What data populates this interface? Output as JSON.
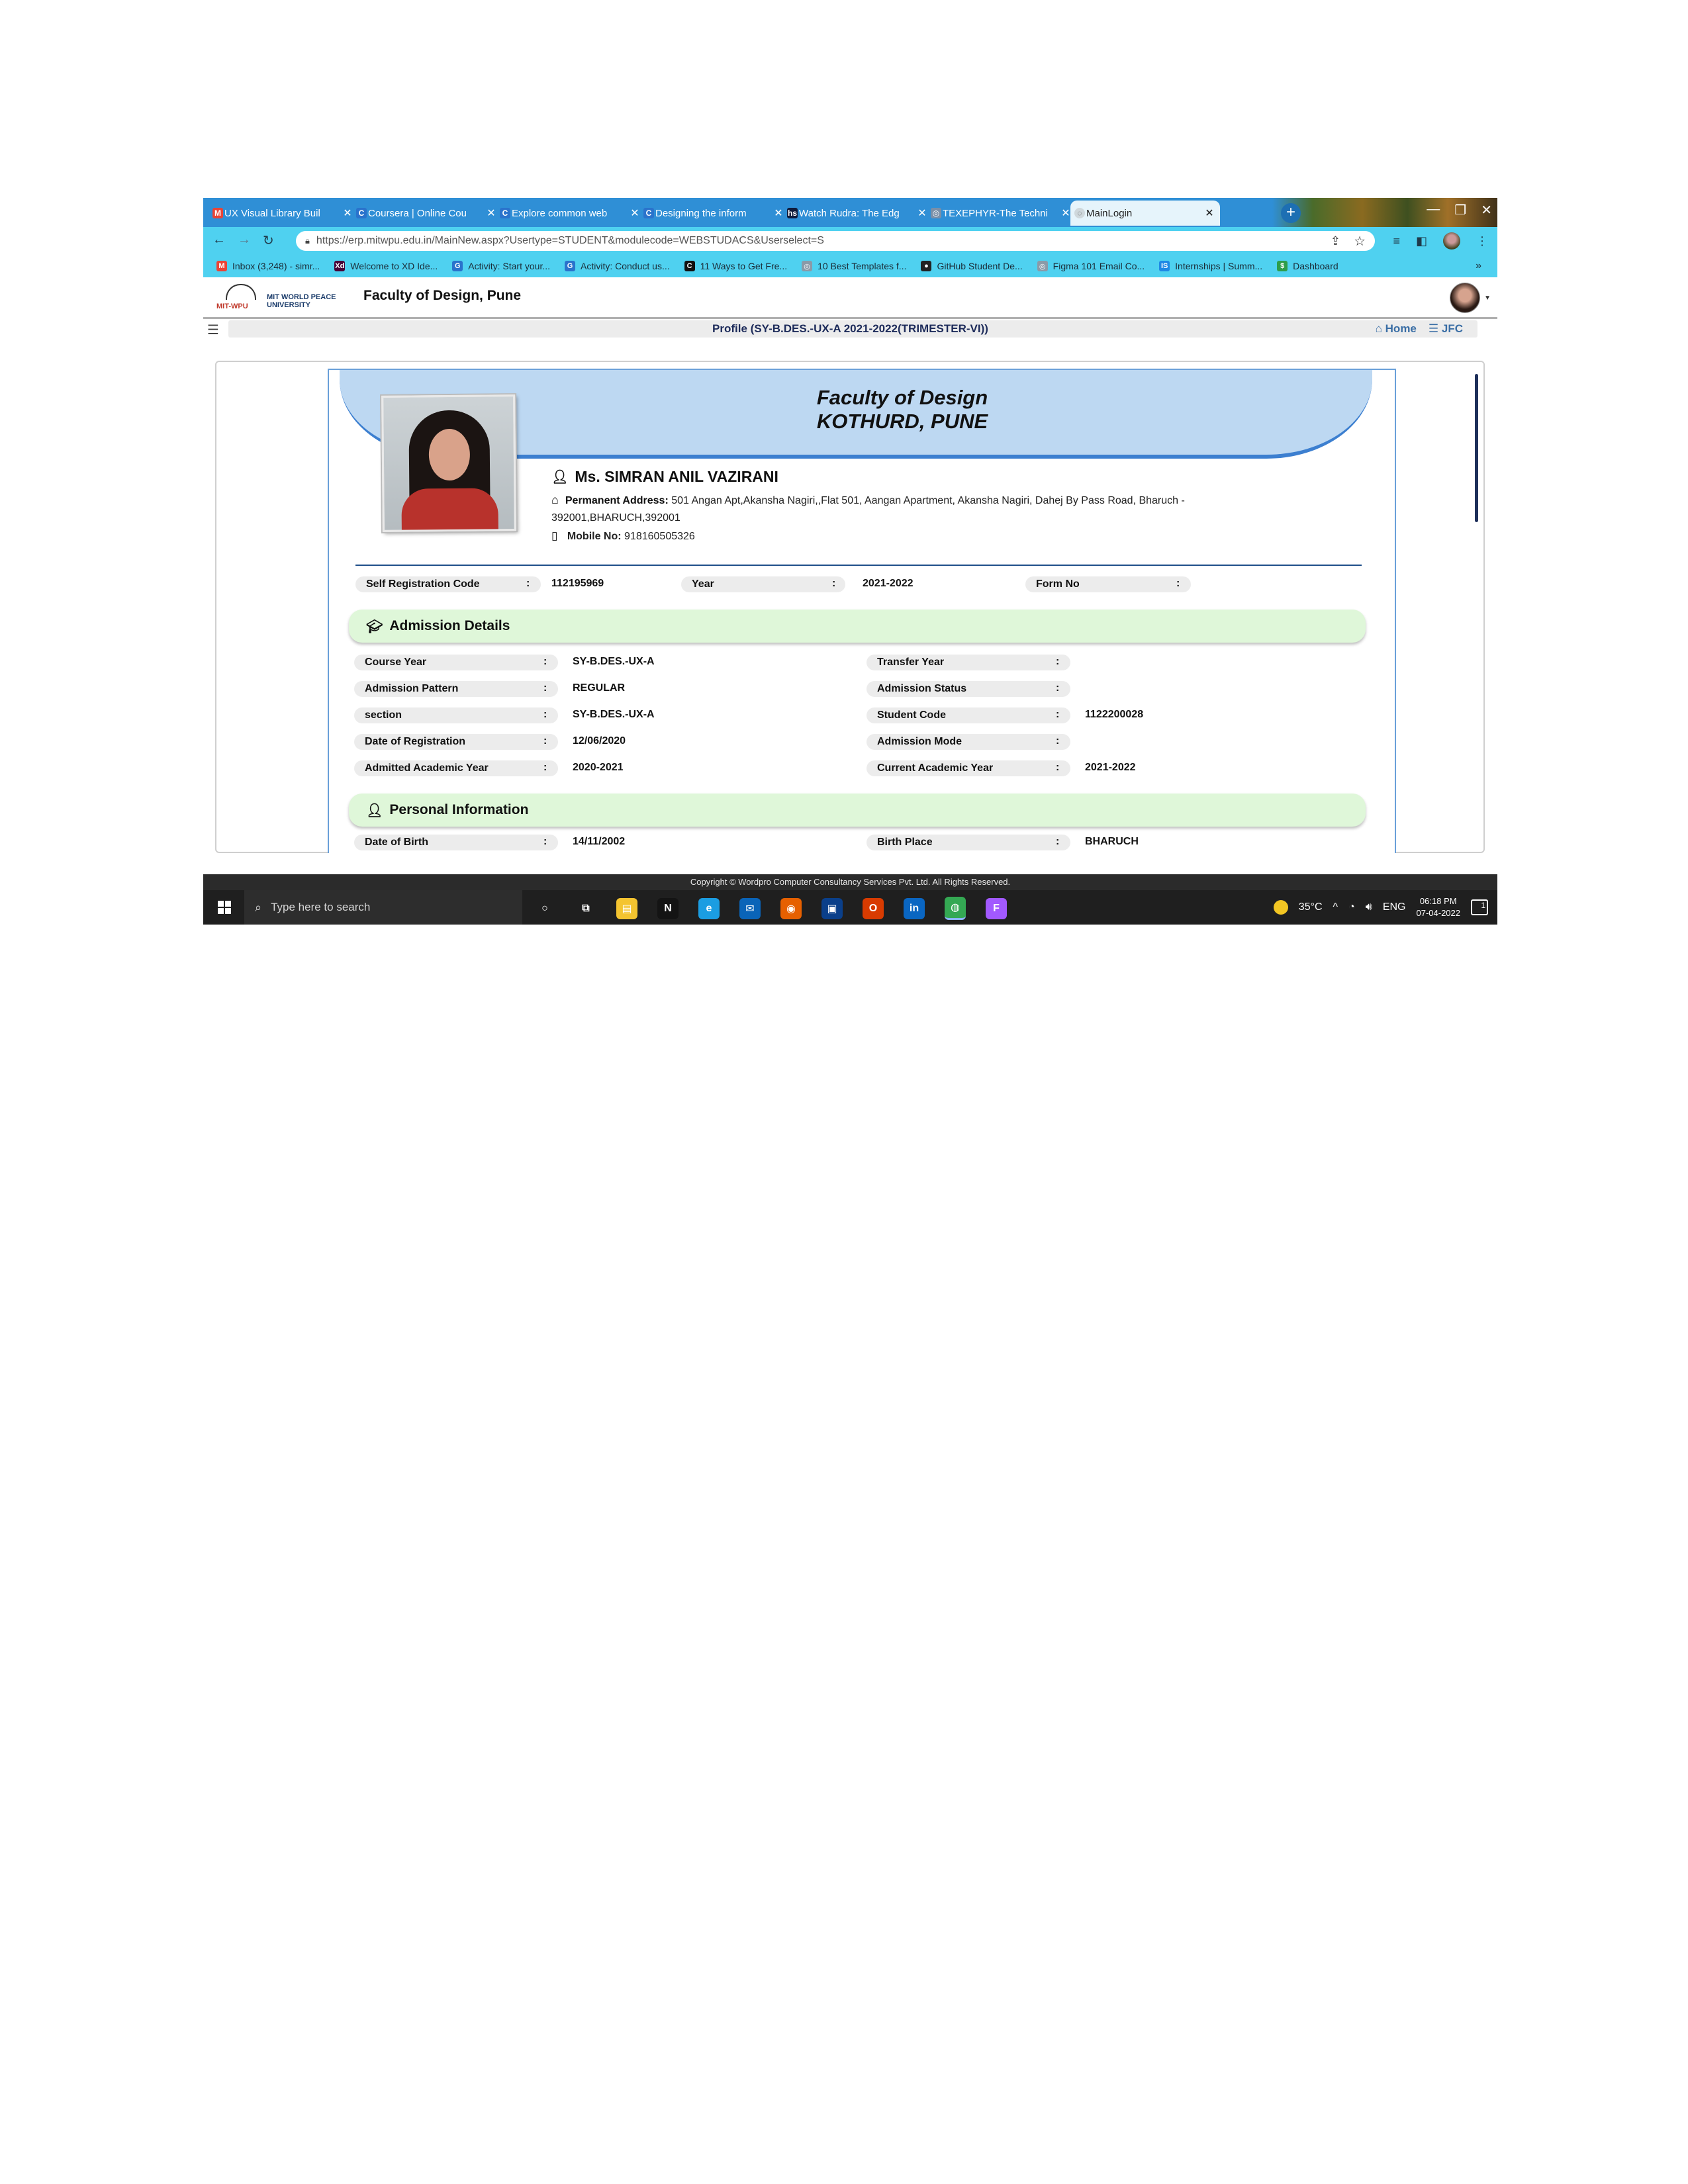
{
  "browser": {
    "tabs": [
      {
        "title": "UX Visual Library Buil",
        "favicon": "gmail-icon",
        "color": "#ea4335",
        "glyph": "M"
      },
      {
        "title": "Coursera | Online Cou",
        "favicon": "coursera-icon",
        "color": "#2a73cc",
        "glyph": "C"
      },
      {
        "title": "Explore common web",
        "favicon": "coursera-icon",
        "color": "#2a73cc",
        "glyph": "C"
      },
      {
        "title": "Designing the inform",
        "favicon": "coursera-icon",
        "color": "#2a73cc",
        "glyph": "C"
      },
      {
        "title": "Watch Rudra: The Edg",
        "favicon": "hotstar-icon",
        "color": "#0f1a3a",
        "glyph": "hs"
      },
      {
        "title": "TEXEPHYR-The Techni",
        "favicon": "globe-icon",
        "color": "#7a8fa8",
        "glyph": "◎"
      },
      {
        "title": "MainLogin",
        "favicon": "loading-icon",
        "color": "#cfd8dc",
        "glyph": "◌",
        "active": true
      }
    ],
    "url": "https://erp.mitwpu.edu.in/MainNew.aspx?Usertype=STUDENT&modulecode=WEBSTUDACS&Userselect=S",
    "bookmarks": [
      {
        "label": "Inbox (3,248) - simr...",
        "icon": "gmail-icon",
        "color": "#ea4335",
        "glyph": "M"
      },
      {
        "label": "Welcome to XD Ide...",
        "icon": "xd-icon",
        "color": "#470137",
        "glyph": "Xd"
      },
      {
        "label": "Activity: Start your...",
        "icon": "google-icon",
        "color": "#2a73cc",
        "glyph": "G"
      },
      {
        "label": "Activity: Conduct us...",
        "icon": "google-icon",
        "color": "#2a73cc",
        "glyph": "G"
      },
      {
        "label": "11 Ways to Get Fre...",
        "icon": "c-icon",
        "color": "#111111",
        "glyph": "C"
      },
      {
        "label": "10 Best Templates f...",
        "icon": "globe-icon",
        "color": "#8a9aa8",
        "glyph": "◎"
      },
      {
        "label": "GitHub Student De...",
        "icon": "github-icon",
        "color": "#222222",
        "glyph": "●"
      },
      {
        "label": "Figma 101 Email Co...",
        "icon": "globe-icon",
        "color": "#8a9aa8",
        "glyph": "◎"
      },
      {
        "label": "Internships | Summ...",
        "icon": "internshala-icon",
        "color": "#1e88e5",
        "glyph": "IS"
      },
      {
        "label": "Dashboard",
        "icon": "dollar-icon",
        "color": "#2e9d4a",
        "glyph": "$"
      }
    ],
    "more": "»"
  },
  "app": {
    "logo_lines": [
      "MIT WORLD PEACE",
      "UNIVERSITY"
    ],
    "logo_mark": "MIT-WPU",
    "header_title": "Faculty of Design, Pune",
    "page_title": "Profile  (SY-B.DES.-UX-A   2021-2022(TRIMESTER-VI))",
    "home_link": "Home",
    "jfc_link": "JFC"
  },
  "profile": {
    "faculty_line1": "Faculty of Design",
    "faculty_line2": "KOTHURD, PUNE",
    "name": "Ms. SIMRAN ANIL VAZIRANI",
    "address_label": "Permanent Address:",
    "address_line1": "501 Angan Apt,Akansha Nagiri,,Flat 501, Aangan Apartment, Akansha Nagiri, Dahej By Pass Road, Bharuch -",
    "address_line2": "392001,BHARUCH,392001",
    "mobile_label": "Mobile No:",
    "mobile": "918160505326",
    "self_reg_label": "Self Registration Code",
    "self_reg_value": "112195969",
    "year_label": "Year",
    "year_value": "2021-2022",
    "form_label": "Form No",
    "form_value": ""
  },
  "admission": {
    "title": "Admission Details",
    "left": [
      {
        "label": "Course Year",
        "value": "SY-B.DES.-UX-A"
      },
      {
        "label": "Admission Pattern",
        "value": "REGULAR"
      },
      {
        "label": "section",
        "value": "SY-B.DES.-UX-A"
      },
      {
        "label": "Date of Registration",
        "value": "12/06/2020"
      },
      {
        "label": "Admitted Academic Year",
        "value": "2020-2021"
      }
    ],
    "right": [
      {
        "label": "Transfer Year",
        "value": ""
      },
      {
        "label": "Admission Status",
        "value": ""
      },
      {
        "label": "Student Code",
        "value": "1122200028"
      },
      {
        "label": "Admission Mode",
        "value": ""
      },
      {
        "label": "Current Academic Year",
        "value": "2021-2022"
      }
    ]
  },
  "personal": {
    "title": "Personal Information",
    "left": [
      {
        "label": "Date of Birth",
        "value": "14/11/2002"
      }
    ],
    "right": [
      {
        "label": "Birth Place",
        "value": "BHARUCH"
      }
    ]
  },
  "footer": {
    "copyright": "Copyright © Wordpro Computer Consultancy Services Pvt. Ltd. All Rights Reserved."
  },
  "taskbar": {
    "search_placeholder": "Type here to search",
    "apps": [
      {
        "name": "cortana-icon",
        "glyph": "○",
        "color": "transparent"
      },
      {
        "name": "task-view-icon",
        "glyph": "⧉",
        "color": "transparent"
      },
      {
        "name": "file-explorer-icon",
        "glyph": "▤",
        "color": "#f4c430"
      },
      {
        "name": "netflix-icon",
        "glyph": "N",
        "color": "#141414"
      },
      {
        "name": "edge-icon",
        "glyph": "e",
        "color": "#1b9de2"
      },
      {
        "name": "mail-icon",
        "glyph": "✉",
        "color": "#0a64b8"
      },
      {
        "name": "firefox-icon",
        "glyph": "◉",
        "color": "#e66000"
      },
      {
        "name": "store-icon",
        "glyph": "▣",
        "color": "#0a3f8a"
      },
      {
        "name": "office-icon",
        "glyph": "O",
        "color": "#d83b01"
      },
      {
        "name": "linkedin-icon",
        "glyph": "in",
        "color": "#0a66c2"
      },
      {
        "name": "chrome-icon",
        "glyph": "◍",
        "color": "#34a853",
        "active": true
      },
      {
        "name": "figma-icon",
        "glyph": "F",
        "color": "#a259ff"
      }
    ],
    "temperature": "35°C",
    "language": "ENG",
    "time": "06:18 PM",
    "date": "07-04-2022",
    "notification_count": "1"
  }
}
